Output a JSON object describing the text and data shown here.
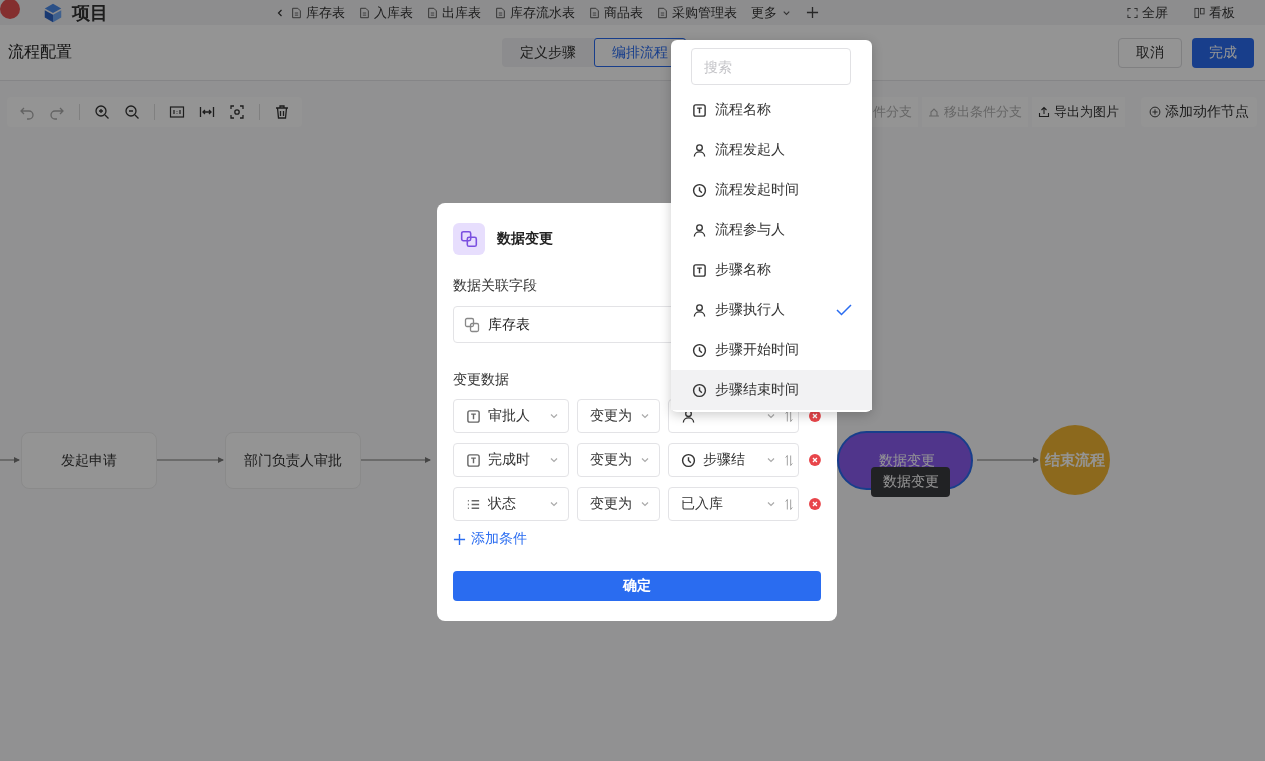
{
  "app_bar": {
    "project": "项目",
    "tabs": [
      {
        "label": "库存表"
      },
      {
        "label": "入库表"
      },
      {
        "label": "出库表"
      },
      {
        "label": "库存流水表"
      },
      {
        "label": "商品表"
      },
      {
        "label": "采购管理表"
      }
    ],
    "more": "更多",
    "fullscreen": "全屏",
    "board": "看板"
  },
  "header": {
    "title": "流程配置",
    "steps": [
      {
        "label": "定义步骤",
        "selected": false
      },
      {
        "label": "编排流程",
        "selected": true
      }
    ],
    "cancel": "取消",
    "done": "完成"
  },
  "toolbar": {
    "actions": [
      {
        "label": "件分支",
        "disabled": true,
        "kind": "plain"
      },
      {
        "label": "移出条件分支",
        "disabled": true,
        "kind": "branch"
      },
      {
        "label": "导出为图片",
        "disabled": false,
        "kind": "export"
      }
    ],
    "add_node": "添加动作节点"
  },
  "flow": {
    "nodes": [
      {
        "label": "发起申请",
        "kind": "step",
        "selected": false
      },
      {
        "label": "部门负责人审批",
        "kind": "step",
        "selected": false
      },
      {
        "label": "数据变更",
        "kind": "action",
        "selected": true
      },
      {
        "label": "结束流程",
        "kind": "end",
        "selected": false
      }
    ],
    "tooltip": "数据变更"
  },
  "dialog": {
    "title": "数据变更",
    "link_label": "数据关联字段",
    "link_value": "库存表",
    "change_label": "变更数据",
    "rows": [
      {
        "field": {
          "kind": "text",
          "text": "审批人"
        },
        "op": "变更为",
        "value": {
          "kind": "person"
        }
      },
      {
        "field": {
          "kind": "text",
          "text": "完成时"
        },
        "op": "变更为",
        "value": {
          "kind": "clock",
          "text": "步骤结"
        }
      },
      {
        "field": {
          "kind": "list",
          "text": "状态"
        },
        "op": "变更为",
        "value": {
          "kind": "plain",
          "text": "已入库"
        }
      }
    ],
    "add": "添加条件",
    "confirm": "确定"
  },
  "dropdown": {
    "placeholder": "搜索",
    "items": [
      {
        "label": "流程名称",
        "kind": "text",
        "selected": false,
        "hovered": false
      },
      {
        "label": "流程发起人",
        "kind": "person",
        "selected": false,
        "hovered": false
      },
      {
        "label": "流程发起时间",
        "kind": "clock",
        "selected": false,
        "hovered": false
      },
      {
        "label": "流程参与人",
        "kind": "person",
        "selected": false,
        "hovered": false
      },
      {
        "label": "步骤名称",
        "kind": "text",
        "selected": false,
        "hovered": false
      },
      {
        "label": "步骤执行人",
        "kind": "person",
        "selected": true,
        "hovered": false
      },
      {
        "label": "步骤开始时间",
        "kind": "clock",
        "selected": false,
        "hovered": false
      },
      {
        "label": "步骤结束时间",
        "kind": "clock",
        "selected": false,
        "hovered": true
      }
    ]
  }
}
